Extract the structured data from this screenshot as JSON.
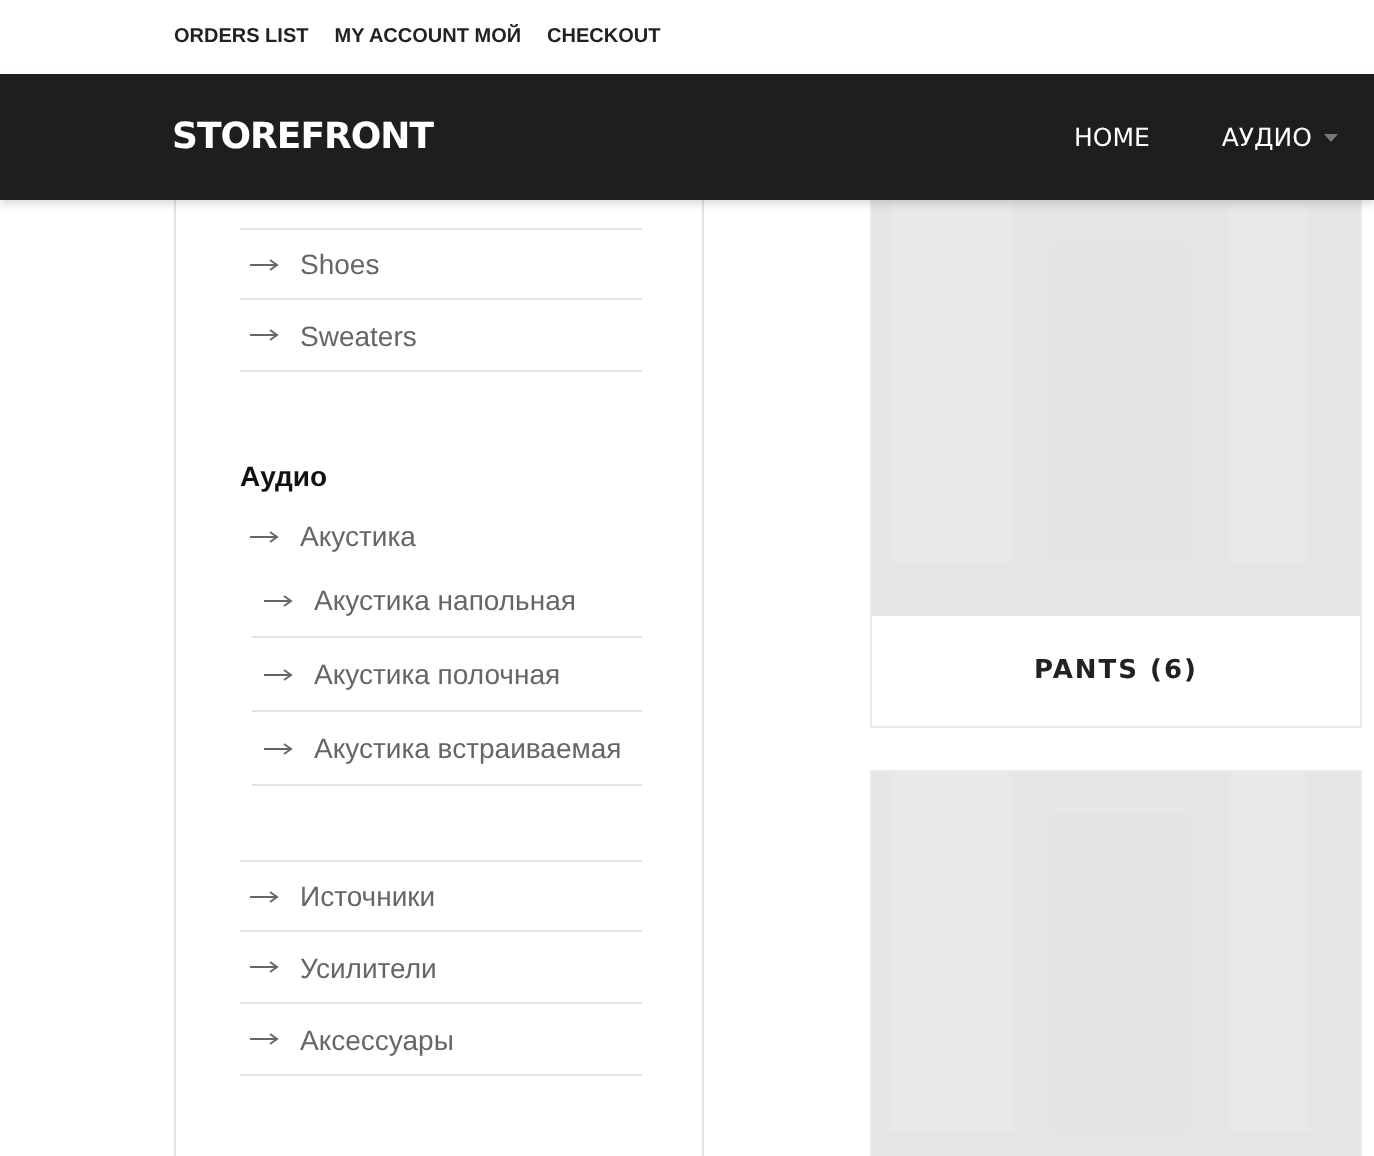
{
  "top_links": [
    "ORDERS LIST",
    "MY ACCOUNT МОЙ",
    "CHECKOUT"
  ],
  "header": {
    "logo": "STOREFRONT",
    "nav": [
      {
        "label": "HOME",
        "dropdown": false
      },
      {
        "label": "АУДИО",
        "dropdown": true
      }
    ]
  },
  "sidebar": {
    "groups": [
      {
        "items": [
          {
            "label": "Shoes"
          },
          {
            "label": "Sweaters"
          }
        ]
      },
      {
        "heading": "Аудио",
        "items": [
          {
            "label": "Акустика",
            "children": [
              {
                "label": "Акустика напольная"
              },
              {
                "label": "Акустика полочная"
              },
              {
                "label": "Акустика встраиваемая"
              }
            ]
          },
          {
            "label": "Источники"
          },
          {
            "label": "Усилители"
          },
          {
            "label": "Аксессуары"
          }
        ]
      }
    ]
  },
  "products": [
    {
      "kind": "picture",
      "title": "PANTS (6)"
    },
    {
      "kind": "picture"
    }
  ]
}
